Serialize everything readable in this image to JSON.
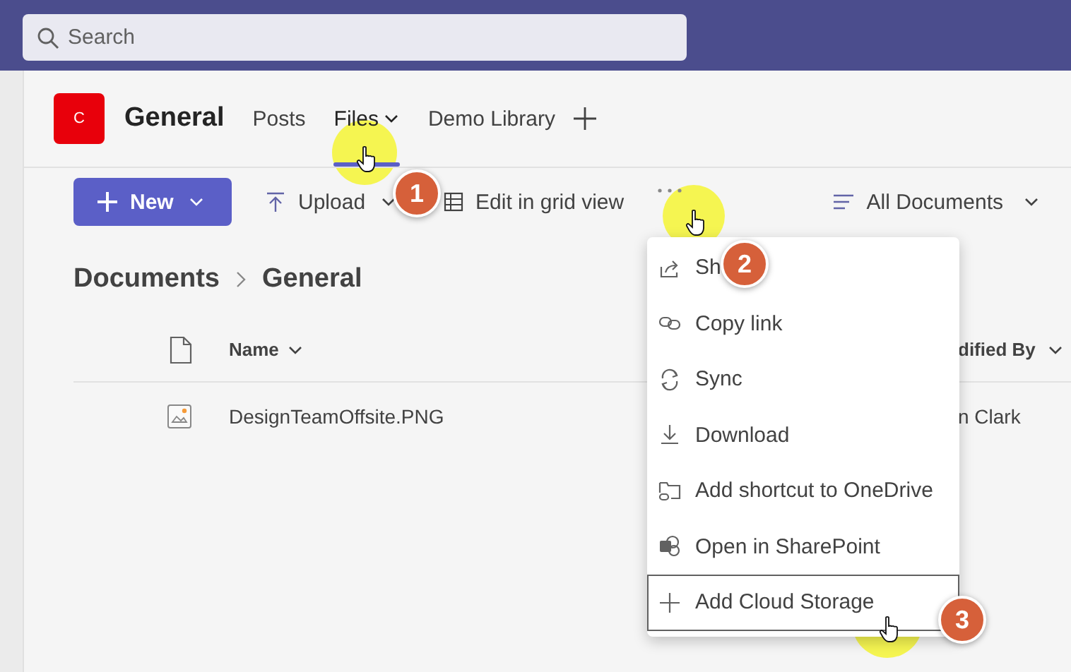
{
  "search": {
    "placeholder": "Search"
  },
  "channel": {
    "initial": "C",
    "name": "General"
  },
  "tabs": [
    {
      "label": "Posts",
      "kind": "plain",
      "selected": false
    },
    {
      "label": "Files",
      "kind": "dropdown",
      "selected": true
    },
    {
      "label": "Demo Library",
      "kind": "plain",
      "selected": false
    }
  ],
  "toolbar": {
    "new_button": "New",
    "actions": [
      {
        "label": "Upload",
        "kind": "upload"
      },
      {
        "label": "Edit in grid view",
        "kind": "grid"
      }
    ],
    "view": "All Documents"
  },
  "breadcrumb": [
    "Documents",
    "General"
  ],
  "table": {
    "columns": [
      {
        "label": "Name"
      },
      {
        "label": "dified By"
      }
    ],
    "rows": [
      {
        "name": "DesignTeamOffsite.PNG",
        "modified_by": "n Clark"
      }
    ]
  },
  "menu": [
    {
      "label": "Sh",
      "kind": "share",
      "selected": false
    },
    {
      "label": "Copy link",
      "kind": "link",
      "selected": false
    },
    {
      "label": "Sync",
      "kind": "sync",
      "selected": false
    },
    {
      "label": "Download",
      "kind": "download",
      "selected": false
    },
    {
      "label": "Add shortcut to OneDrive",
      "kind": "shortcut",
      "selected": false
    },
    {
      "label": "Open in SharePoint",
      "kind": "sharepoint",
      "selected": false
    },
    {
      "label": "Add Cloud Storage",
      "kind": "add",
      "selected": true
    }
  ],
  "steps": [
    "1",
    "2",
    "3"
  ]
}
